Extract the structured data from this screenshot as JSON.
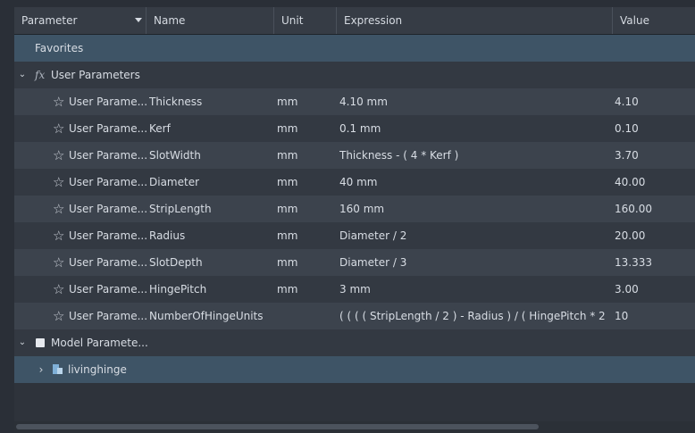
{
  "columns": {
    "parameter": "Parameter",
    "name": "Name",
    "unit": "Unit",
    "expression": "Expression",
    "value": "Value"
  },
  "favorites_label": "Favorites",
  "user_group_label": "User Parameters",
  "model_group_label": "Model Paramete...",
  "model_child_label": "livinghinge",
  "params": [
    {
      "param": "User Parame...",
      "name": "Thickness",
      "unit": "mm",
      "expression": "4.10 mm",
      "value": "4.10"
    },
    {
      "param": "User Parame...",
      "name": "Kerf",
      "unit": "mm",
      "expression": "0.1 mm",
      "value": "0.10"
    },
    {
      "param": "User Parame...",
      "name": "SlotWidth",
      "unit": "mm",
      "expression": "Thickness - ( 4 * Kerf )",
      "value": "3.70"
    },
    {
      "param": "User Parame...",
      "name": "Diameter",
      "unit": "mm",
      "expression": "40 mm",
      "value": "40.00"
    },
    {
      "param": "User Parame...",
      "name": "StripLength",
      "unit": "mm",
      "expression": "160 mm",
      "value": "160.00"
    },
    {
      "param": "User Parame...",
      "name": "Radius",
      "unit": "mm",
      "expression": "Diameter / 2",
      "value": "20.00"
    },
    {
      "param": "User Parame...",
      "name": "SlotDepth",
      "unit": "mm",
      "expression": "Diameter / 3",
      "value": "13.333"
    },
    {
      "param": "User Parame...",
      "name": "HingePitch",
      "unit": "mm",
      "expression": "3 mm",
      "value": "3.00"
    },
    {
      "param": "User Parame...",
      "name": "NumberOfHingeUnits",
      "unit": "",
      "expression": "( ( ( ( StripLength / 2 ) - Radius ) / ( HingePitch * 2 ) ...",
      "value": "10"
    }
  ]
}
